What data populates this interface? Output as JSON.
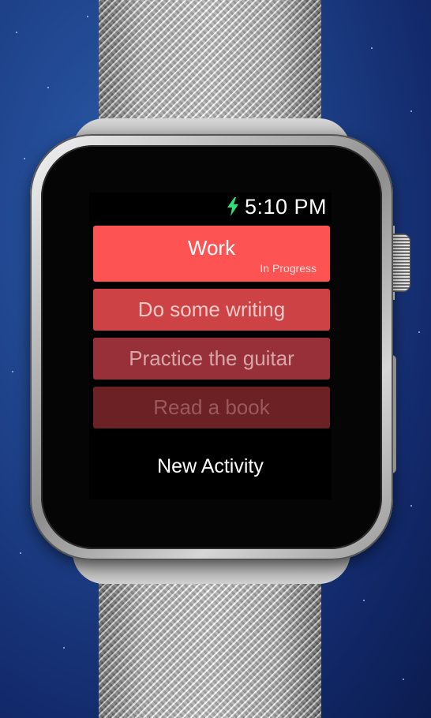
{
  "status": {
    "time": "5:10 PM",
    "charging_icon": "charging-bolt-icon",
    "charging_color": "#2ee07a"
  },
  "activities": [
    {
      "label": "Work",
      "status": "In Progress",
      "color": "#fd5352",
      "text_color": "#ffffff"
    },
    {
      "label": "Do some writing",
      "status": "",
      "color": "#cd4345",
      "text_color": "#f0c9c9"
    },
    {
      "label": "Practice the guitar",
      "status": "",
      "color": "#98303a",
      "text_color": "#d7a6a8"
    },
    {
      "label": "Read a book",
      "status": "",
      "color": "#6c2124",
      "text_color": "#9a5a5c"
    }
  ],
  "new_activity_label": "New Activity"
}
